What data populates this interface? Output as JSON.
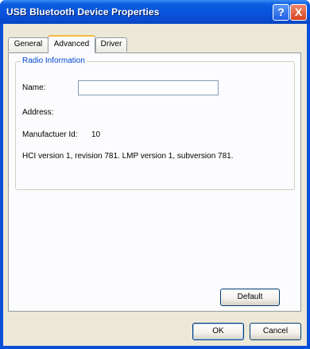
{
  "window": {
    "title": "USB Bluetooth Device Properties",
    "help_label": "?",
    "close_label": "X"
  },
  "tabs": [
    {
      "label": "General",
      "active": false
    },
    {
      "label": "Advanced",
      "active": true
    },
    {
      "label": "Driver",
      "active": false
    }
  ],
  "radio_info": {
    "group_title": "Radio Information",
    "name_label": "Name:",
    "name_value": "",
    "address_label": "Address:",
    "manufacturer_label": "Manufactuer Id:",
    "manufacturer_value": "10",
    "version_text": "HCI version 1, revision 781.  LMP version 1, subversion 781."
  },
  "buttons": {
    "default": "Default",
    "ok": "OK",
    "cancel": "Cancel"
  },
  "colors": {
    "titlebar": "#0a52dc",
    "dialog_bg": "#ece9d8",
    "group_title": "#0046d5",
    "active_tab_accent": "#f7b743"
  }
}
